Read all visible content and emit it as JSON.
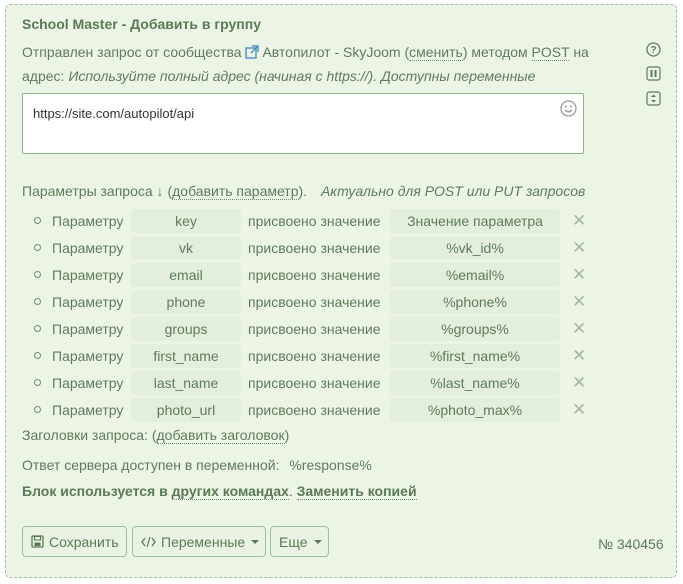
{
  "title": "School Master - Добавить в группу",
  "description": {
    "prefix": "Отправлен запрос от сообщества",
    "community": "Автопилот - SkyJoom",
    "change_link": "сменить",
    "method_prefix": "методом",
    "method": "POST",
    "suffix": "на адрес:",
    "hint": "Используйте полный адрес (начиная с https://). Доступны переменные"
  },
  "url_input": {
    "value": "https://site.com/autopilot/api"
  },
  "params": {
    "label": "Параметры запроса ↓",
    "add_link": "добавить параметр",
    "note": "Актуально для POST или PUT запросов",
    "param_word": "Параметру",
    "assign_word": "присвоено значение",
    "rows": [
      {
        "key": "key",
        "value": "Значение параметра"
      },
      {
        "key": "vk",
        "value": "%vk_id%"
      },
      {
        "key": "email",
        "value": "%email%"
      },
      {
        "key": "phone",
        "value": "%phone%"
      },
      {
        "key": "groups",
        "value": "%groups%"
      },
      {
        "key": "first_name",
        "value": "%first_name%"
      },
      {
        "key": "last_name",
        "value": "%last_name%"
      },
      {
        "key": "photo_url",
        "value": "%photo_max%"
      }
    ]
  },
  "headers": {
    "label": "Заголовки запроса:",
    "add_link": "добавить заголовок"
  },
  "response": {
    "label": "Ответ сервера доступен в переменной:",
    "var": "%response%"
  },
  "block_usage": {
    "text": "Блок используется в",
    "link": "других командах",
    "copy_link": "Заменить копией"
  },
  "buttons": {
    "save": "Сохранить",
    "variables": "Переменные",
    "more": "Еще"
  },
  "number": "№ 340456",
  "icons": {
    "help": "help-circle-icon",
    "pause": "pause-icon",
    "expand": "expand-icon",
    "external": "external-link-icon",
    "smile": "smile-icon",
    "save": "floppy-disk-icon",
    "code": "code-icon",
    "delete": "close-icon"
  },
  "colors": {
    "panel_bg": "#ecf5e5",
    "panel_border": "#9cbf9c",
    "text": "#5f7b5a",
    "accent": "#4a90c8"
  }
}
